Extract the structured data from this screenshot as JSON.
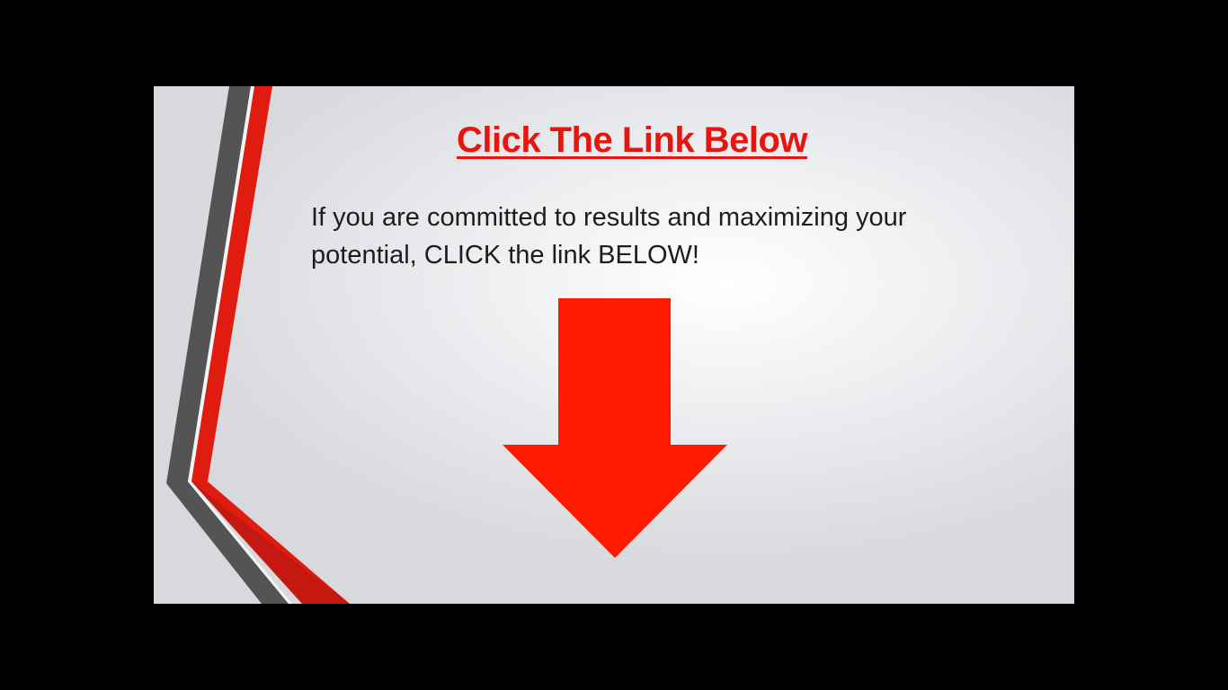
{
  "slide": {
    "title": "Click The Link Below",
    "body": "If you are committed to results and maximizing your potential, CLICK the link BELOW!",
    "accent_color": "#ff1a00",
    "stripe_dark_color": "#555555",
    "icon": "arrow-down-icon"
  }
}
